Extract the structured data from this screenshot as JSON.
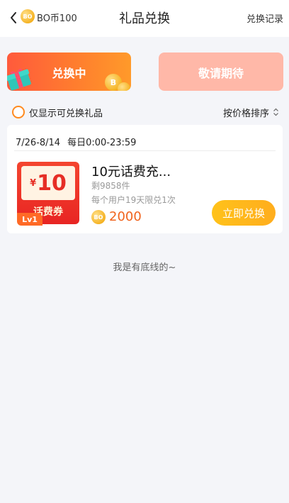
{
  "header": {
    "balance": "BO币100",
    "coin_icon_text": "BO",
    "title": "礼品兑换",
    "record_link": "兑换记录"
  },
  "tabs": [
    {
      "label": "兑换中",
      "active": true
    },
    {
      "label": "敬请期待",
      "active": false
    }
  ],
  "filter": {
    "label": "仅显示可兑换礼品",
    "checked": false
  },
  "sort": {
    "label": "按价格排序"
  },
  "gift_card": {
    "date_range": "7/26-8/14",
    "daily_time": "每日0:00-23:59",
    "voucher_currency": "¥",
    "voucher_amount": "10",
    "voucher_text": "话费券",
    "level_badge": "Lv1",
    "name": "10元话费充...",
    "stock": "剩9858件",
    "limit": "每个用户19天限兑1次",
    "price": "2000",
    "redeem_label": "立即兑换"
  },
  "footer_note": "我是有底线的~",
  "colors": {
    "accent_orange": "#ff7d2e",
    "inactive_tab": "#ffb8a8",
    "redeem_button": "#ffb71c",
    "price_text": "#f0641e",
    "voucher_red": "#e82523"
  }
}
